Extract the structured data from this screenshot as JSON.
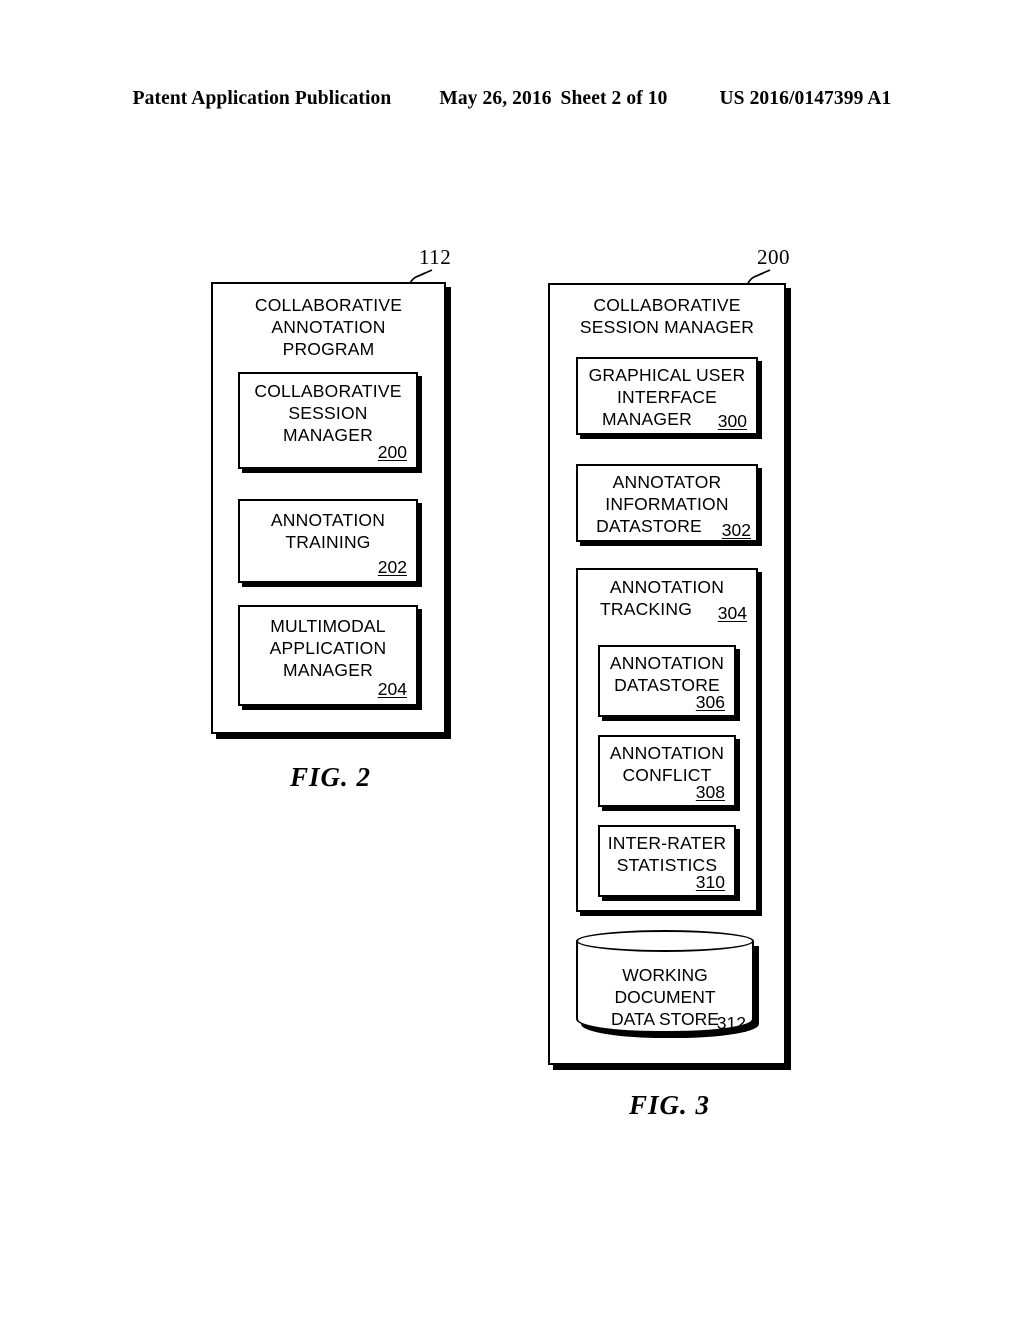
{
  "header": {
    "publication": "Patent Application Publication",
    "date": "May 26, 2016",
    "sheet": "Sheet 2 of 10",
    "patent_number": "US 2016/0147399 A1"
  },
  "figures": [
    {
      "caption": "FIG. 2",
      "outer": {
        "ref": "112",
        "title_lines": [
          "COLLABORATIVE",
          "ANNOTATION",
          "PROGRAM"
        ],
        "children": [
          {
            "ref": "200",
            "lines": [
              "COLLABORATIVE",
              "SESSION",
              "MANAGER"
            ],
            "ref_placement": "own-line"
          },
          {
            "ref": "202",
            "lines": [
              "ANNOTATION",
              "TRAINING"
            ],
            "ref_placement": "own-line"
          },
          {
            "ref": "204",
            "lines": [
              "MULTIMODAL",
              "APPLICATION",
              "MANAGER"
            ],
            "ref_placement": "own-line"
          }
        ]
      }
    },
    {
      "caption": "FIG. 3",
      "outer": {
        "ref": "200",
        "title_lines": [
          "COLLABORATIVE",
          "SESSION MANAGER"
        ],
        "children": [
          {
            "ref": "300",
            "lines": [
              "GRAPHICAL USER",
              "INTERFACE",
              "MANAGER"
            ],
            "ref_placement": "inline"
          },
          {
            "ref": "302",
            "lines": [
              "ANNOTATOR",
              "INFORMATION",
              "DATASTORE"
            ],
            "ref_placement": "inline"
          },
          {
            "ref": "304",
            "lines": [
              "ANNOTATION",
              "TRACKING"
            ],
            "ref_placement": "inline",
            "children": [
              {
                "ref": "306",
                "lines": [
                  "ANNOTATION",
                  "DATASTORE"
                ],
                "ref_placement": "own-line"
              },
              {
                "ref": "308",
                "lines": [
                  "ANNOTATION",
                  "CONFLICT"
                ],
                "ref_placement": "own-line"
              },
              {
                "ref": "310",
                "lines": [
                  "INTER-RATER",
                  "STATISTICS"
                ],
                "ref_placement": "own-line"
              }
            ]
          },
          {
            "ref": "312",
            "shape": "cylinder",
            "lines": [
              "WORKING",
              "DOCUMENT",
              "DATA STORE"
            ],
            "ref_placement": "inline"
          }
        ]
      }
    }
  ],
  "colors": {
    "ink": "#000000",
    "paper": "#ffffff"
  }
}
